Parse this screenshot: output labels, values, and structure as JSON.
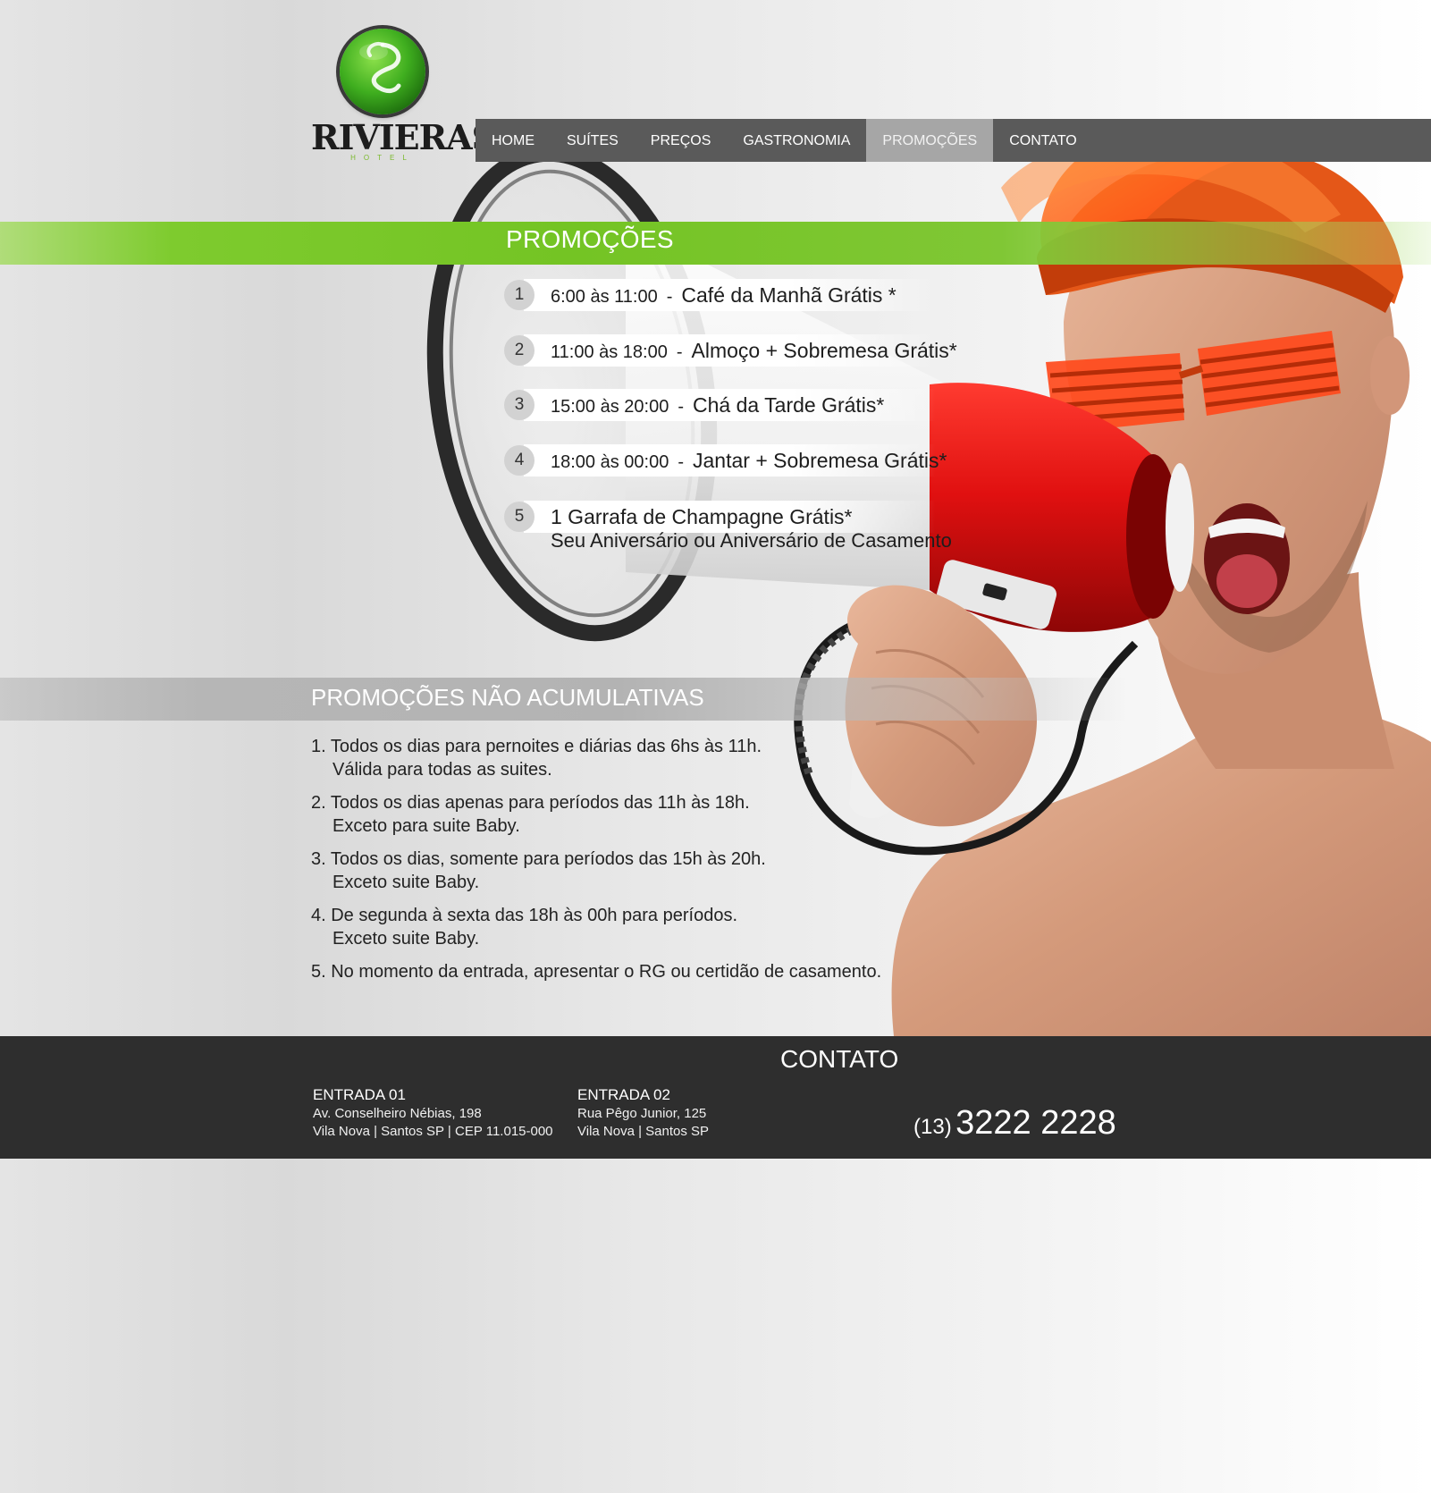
{
  "brand": {
    "name": "RIVIERAS",
    "subtitle": "HOTEL",
    "accent_color": "#74c424",
    "nav_color": "#5a5a5a",
    "footer_color": "#2e2e2e"
  },
  "nav": {
    "items": [
      {
        "label": "HOME",
        "active": false
      },
      {
        "label": "SUÍTES",
        "active": false
      },
      {
        "label": "PREÇOS",
        "active": false
      },
      {
        "label": "GASTRONOMIA",
        "active": false
      },
      {
        "label": "PROMOÇÕES",
        "active": true
      },
      {
        "label": "CONTATO",
        "active": false
      }
    ]
  },
  "hero": {
    "icon": "megaphone-man-illustration"
  },
  "promocoes": {
    "title": "PROMOÇÕES",
    "items": [
      {
        "number": "1",
        "time": "6:00 às 11:00",
        "separator": "-",
        "desc": "Café da Manhã Grátis *"
      },
      {
        "number": "2",
        "time": "11:00 às 18:00",
        "separator": "-",
        "desc": "Almoço + Sobremesa Grátis*"
      },
      {
        "number": "3",
        "time": "15:00 às 20:00",
        "separator": "-",
        "desc": "Chá da Tarde Grátis*"
      },
      {
        "number": "4",
        "time": "18:00 às 00:00",
        "separator": "-",
        "desc": "Jantar + Sobremesa Grátis*"
      },
      {
        "number": "5",
        "line1": "1 Garrafa de Champagne Grátis*",
        "line2": "Seu Aniversário ou Aniversário de Casamento"
      }
    ]
  },
  "nao_acumulativas": {
    "title": "PROMOÇÕES NÃO ACUMULATIVAS",
    "items": [
      {
        "line1": "1. Todos os dias para pernoites e diárias das 6hs às 11h.",
        "line2": "Válida para todas as suites."
      },
      {
        "line1": "2. Todos os dias apenas para períodos das 11h às 18h.",
        "line2": "Exceto para suite Baby."
      },
      {
        "line1": "3. Todos os dias, somente para períodos das 15h às 20h.",
        "line2": "Exceto suite Baby."
      },
      {
        "line1": "4. De segunda à sexta das 18h às 00h para períodos.",
        "line2": "Exceto suite Baby."
      },
      {
        "line1": "5. No momento da entrada, apresentar o RG ou certidão de casamento.",
        "line2": ""
      }
    ]
  },
  "footer": {
    "title": "CONTATO",
    "entrada_1": {
      "title": "ENTRADA 01",
      "address": "Av. Conselheiro Nébias, 198",
      "city": "Vila Nova | Santos SP | CEP 11.015-000"
    },
    "entrada_2": {
      "title": "ENTRADA 02",
      "address": "Rua Pêgo Junior, 125",
      "city": "Vila Nova | Santos SP"
    },
    "phone": {
      "ddd": "(13)",
      "number": "3222 2228"
    }
  }
}
